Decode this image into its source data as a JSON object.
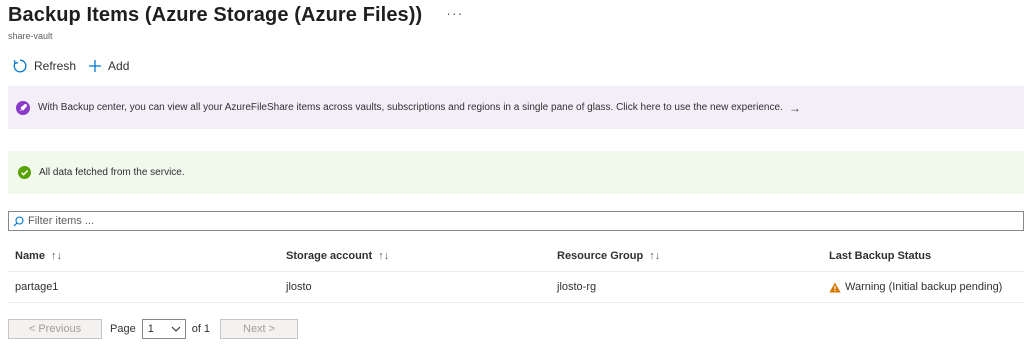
{
  "header": {
    "title": "Backup Items (Azure Storage (Azure Files))",
    "more": "···",
    "subtitle": "share-vault"
  },
  "toolbar": {
    "refresh_label": "Refresh",
    "add_label": "Add"
  },
  "info_banner": {
    "text": "With Backup center, you can view all your AzureFileShare items across vaults, subscriptions and regions in a single pane of glass. Click here to use the new experience.",
    "arrow": "→"
  },
  "success_banner": {
    "text": "All data fetched from the service."
  },
  "filter": {
    "placeholder": "Filter items ..."
  },
  "table": {
    "columns": [
      "Name",
      "Storage account",
      "Resource Group",
      "Last Backup Status"
    ],
    "sort_icon": "↑↓",
    "rows": [
      {
        "name": "partage1",
        "storage_account": "jlosto",
        "resource_group": "jlosto-rg",
        "status": "Warning (Initial backup pending)"
      }
    ]
  },
  "pager": {
    "previous_label": "< Previous",
    "page_label": "Page",
    "current_page": "1",
    "of_label": "of 1",
    "next_label": "Next >"
  },
  "colors": {
    "info_bg": "#f3eef8",
    "info_icon": "#8a3ac9",
    "success_bg": "#f1f8ec",
    "success_icon": "#57a300",
    "warning_icon": "#d47500",
    "accent": "#0078d4"
  }
}
